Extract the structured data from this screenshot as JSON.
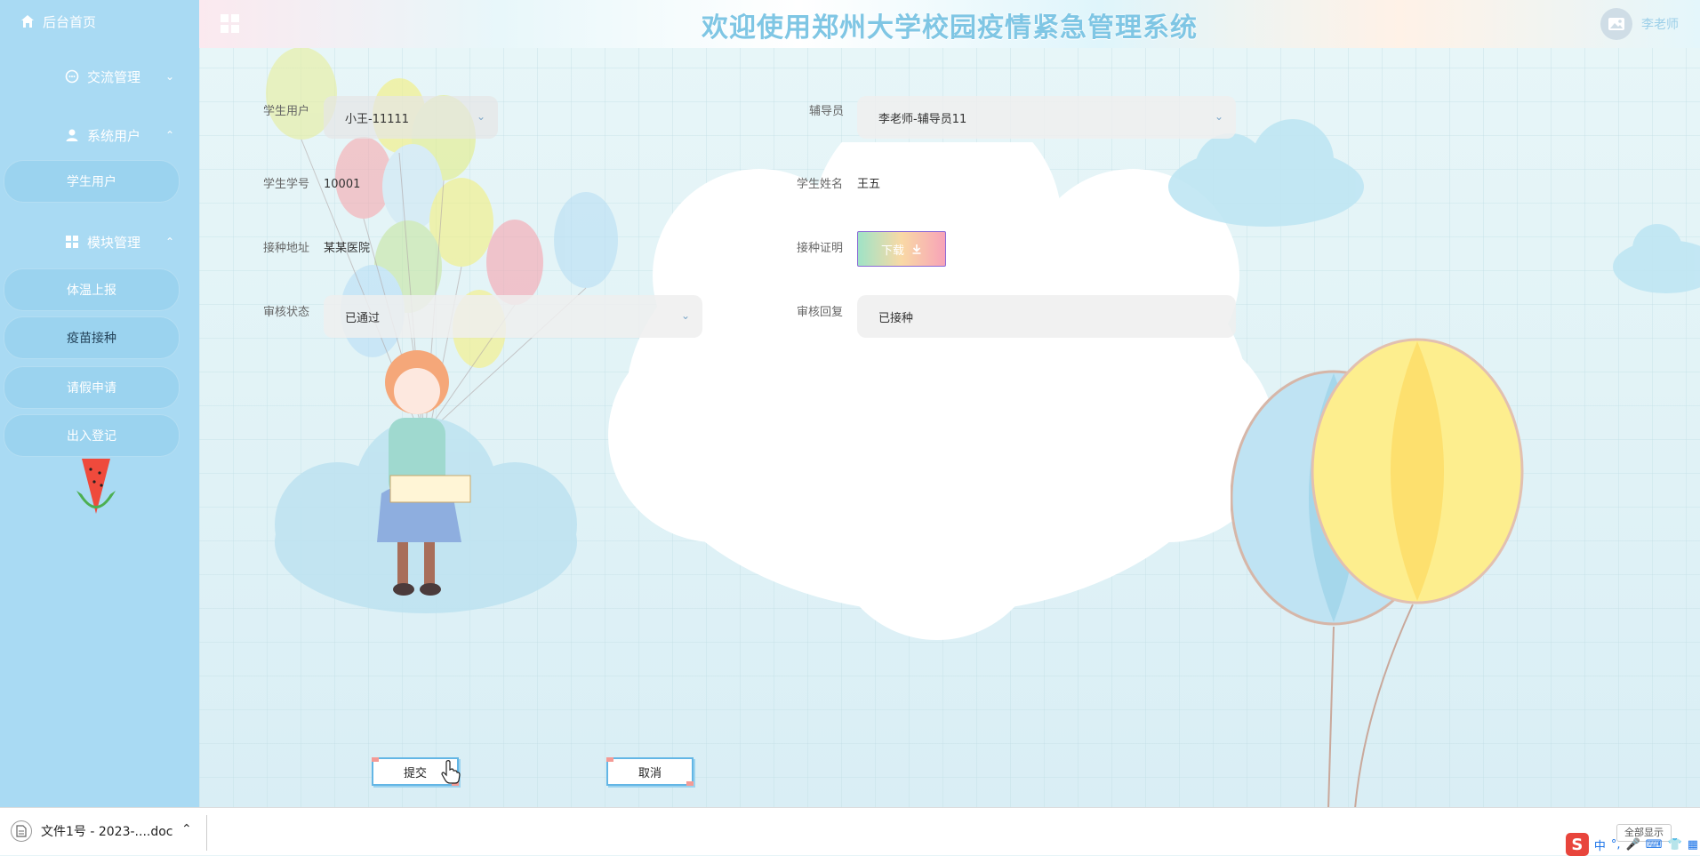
{
  "sidebar": {
    "home": "后台首页",
    "menu": [
      {
        "label": "交流管理",
        "expanded": false
      },
      {
        "label": "系统用户",
        "expanded": true,
        "children": [
          "学生用户"
        ]
      },
      {
        "label": "模块管理",
        "expanded": true,
        "children": [
          "体温上报",
          "疫苗接种",
          "请假申请",
          "出入登记"
        ]
      }
    ],
    "active": "疫苗接种"
  },
  "header": {
    "title": "欢迎使用郑州大学校园疫情紧急管理系统",
    "user": "李老师"
  },
  "form": {
    "student_user": {
      "label": "学生用户",
      "value": "小王-11111"
    },
    "counselor": {
      "label": "辅导员",
      "value": "李老师-辅导员11"
    },
    "student_no": {
      "label": "学生学号",
      "value": "10001"
    },
    "student_name": {
      "label": "学生姓名",
      "value": "王五"
    },
    "vacc_address": {
      "label": "接种地址",
      "value": "某某医院"
    },
    "vacc_cert": {
      "label": "接种证明",
      "button": "下载"
    },
    "review_status": {
      "label": "审核状态",
      "value": "已通过"
    },
    "review_reply": {
      "label": "审核回复",
      "value": "已接种"
    },
    "submit": "提交",
    "cancel": "取消"
  },
  "taskbar": {
    "file": "文件1号 - 2023-....doc",
    "show_all": "全部显示",
    "ime": "中"
  },
  "colors": {
    "sidebar": "#a9daf3",
    "title": "#7fc6e4",
    "button_border": "#63b6e5"
  }
}
